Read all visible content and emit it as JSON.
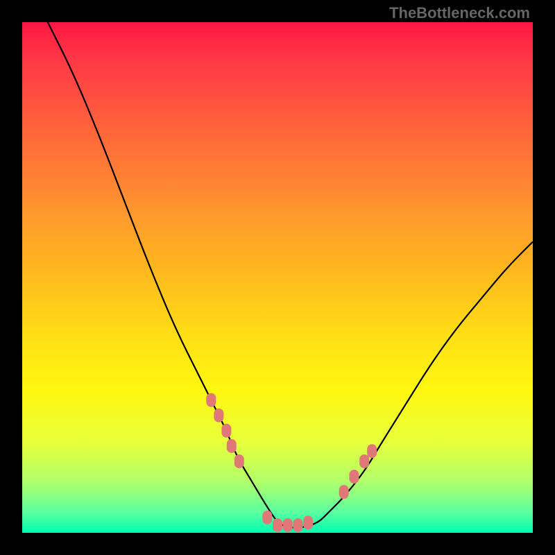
{
  "attribution": "TheBottleneck.com",
  "chart_data": {
    "type": "line",
    "title": "",
    "xlabel": "",
    "ylabel": "",
    "xlim": [
      0,
      100
    ],
    "ylim": [
      0,
      100
    ],
    "background_gradient": {
      "type": "vertical",
      "stops": [
        {
          "offset": 0,
          "color": "#ff1744"
        },
        {
          "offset": 8,
          "color": "#ff3b45"
        },
        {
          "offset": 18,
          "color": "#ff5a3d"
        },
        {
          "offset": 28,
          "color": "#ff7a35"
        },
        {
          "offset": 38,
          "color": "#ff9a2d"
        },
        {
          "offset": 46,
          "color": "#ffb020"
        },
        {
          "offset": 54,
          "color": "#ffc81a"
        },
        {
          "offset": 62,
          "color": "#ffe015"
        },
        {
          "offset": 72,
          "color": "#fff70f"
        },
        {
          "offset": 82,
          "color": "#e8ff3a"
        },
        {
          "offset": 90,
          "color": "#b0ff6a"
        },
        {
          "offset": 96,
          "color": "#5affa0"
        },
        {
          "offset": 100,
          "color": "#00ffb0"
        }
      ]
    },
    "series": [
      {
        "name": "bottleneck-curve",
        "type": "line",
        "color": "#000000",
        "x": [
          5,
          10,
          15,
          20,
          25,
          30,
          35,
          38,
          40,
          42,
          45,
          48,
          50,
          52,
          55,
          58,
          60,
          63,
          67,
          70,
          75,
          80,
          85,
          90,
          95,
          100
        ],
        "y": [
          100,
          90,
          78,
          65,
          52,
          40,
          30,
          24,
          20,
          15,
          10,
          5,
          2,
          1,
          1,
          2,
          4,
          7,
          12,
          17,
          25,
          33,
          40,
          46,
          52,
          57
        ]
      },
      {
        "name": "highlight-markers",
        "type": "scatter",
        "color": "#e07878",
        "marker_shape": "rounded-rect",
        "x": [
          37,
          38.5,
          40,
          41,
          42.5,
          48,
          50,
          52,
          54,
          56,
          63,
          65,
          67,
          68.5
        ],
        "y": [
          26,
          23,
          20,
          17,
          14,
          3,
          1.5,
          1.5,
          1.5,
          2,
          8,
          11,
          14,
          16
        ]
      }
    ]
  }
}
